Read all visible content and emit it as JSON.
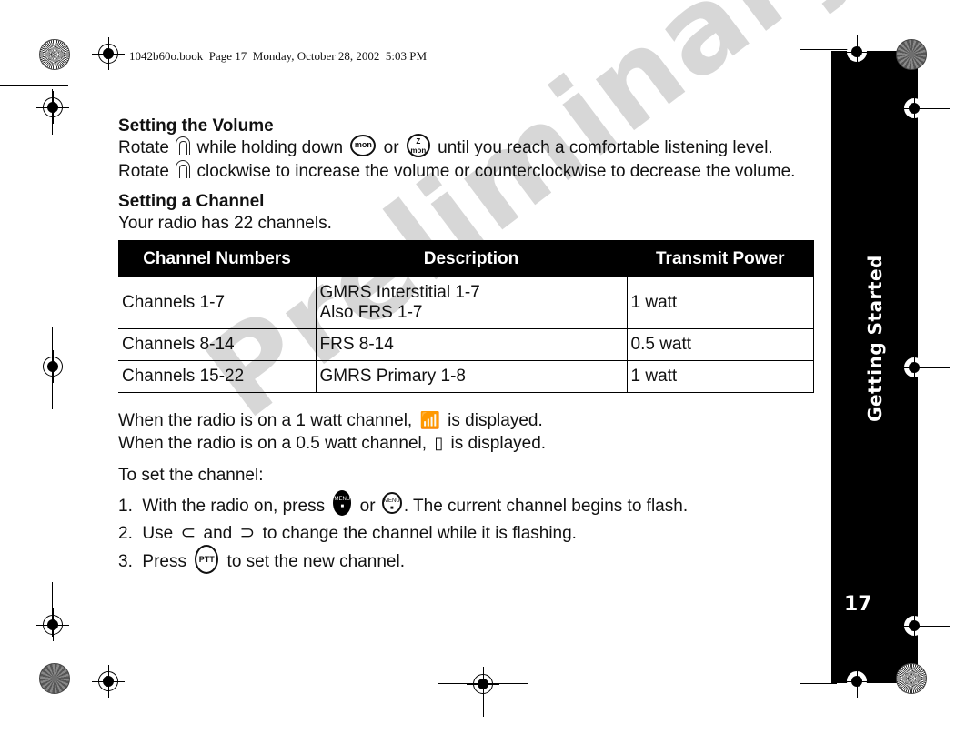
{
  "print_header": "1042b60o.book  Page 17  Monday, October 28, 2002  5:03 PM",
  "side_tab": {
    "section_title": "Getting Started",
    "page_number": "17"
  },
  "watermark": "Preliminary",
  "volume_section": {
    "heading": "Setting the Volume",
    "text_parts": [
      "Rotate ",
      " while holding down ",
      " or ",
      " until you reach a comfortable listening level. Rotate ",
      " clockwise to increase the volume or counterclockwise to decrease the volume."
    ],
    "icons": {
      "volume_knob": "volume-knob-icon",
      "monitor_button": "mon",
      "monitor_scan_button": "mon"
    }
  },
  "channel_section": {
    "heading": "Setting a Channel",
    "intro": "Your radio has 22 channels.",
    "table": {
      "headers": [
        "Channel Numbers",
        "Description",
        "Transmit Power"
      ],
      "rows": [
        {
          "channels": "Channels 1-7",
          "description_line1": "GMRS Interstitial 1-7",
          "description_line2": "Also FRS 1-7",
          "power": "1 watt"
        },
        {
          "channels": "Channels 8-14",
          "description_line1": "FRS 8-14",
          "description_line2": "",
          "power": "0.5 watt"
        },
        {
          "channels": "Channels 15-22",
          "description_line1": "GMRS Primary 1-8",
          "description_line2": "",
          "power": "1 watt"
        }
      ]
    },
    "power_notes": [
      {
        "before": "When the radio is on a 1 watt channel, ",
        "after": " is displayed.",
        "icon": "high-power-icon"
      },
      {
        "before": "When the radio is on a 0.5 watt channel, ",
        "after": " is displayed.",
        "icon": "low-power-icon"
      }
    ],
    "steps_intro": "To set the channel:",
    "steps": [
      {
        "num": "1.",
        "before": "With the radio on, press ",
        "mid": " or ",
        "after": ". The current channel begins to flash."
      },
      {
        "num": "2.",
        "before": "Use ",
        "mid": " and ",
        "after": " to change the channel while it is flashing."
      },
      {
        "num": "3.",
        "before": "Press ",
        "after": " to set the new channel."
      }
    ],
    "button_labels": {
      "menu": "MENU",
      "ptt": "PTT",
      "mon": "mon",
      "minus": "−",
      "plus": "+"
    }
  }
}
